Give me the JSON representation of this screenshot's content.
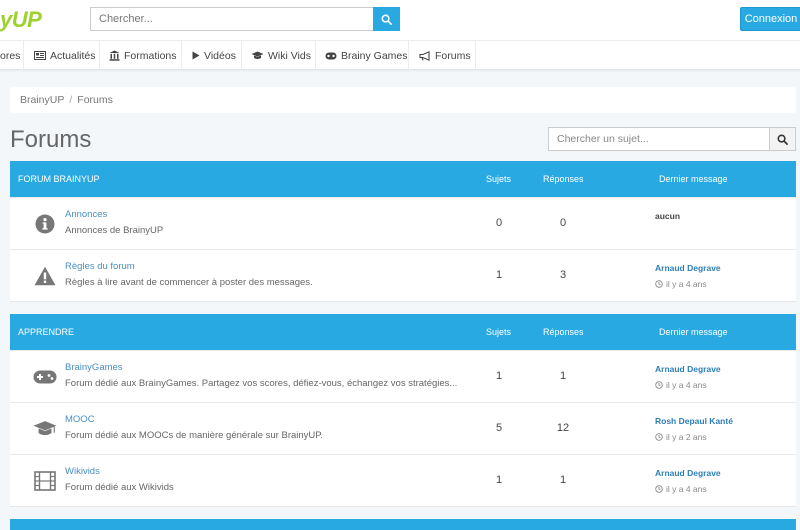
{
  "header": {
    "logo_text": "yUP",
    "search_placeholder": "Chercher...",
    "login_label": "Connexion"
  },
  "nav": {
    "items": [
      {
        "label": "ores",
        "icon": "none"
      },
      {
        "label": "Actualités",
        "icon": "newspaper-icon"
      },
      {
        "label": "Formations",
        "icon": "institution-icon"
      },
      {
        "label": "Vidéos",
        "icon": "play-icon"
      },
      {
        "label": "Wiki Vids",
        "icon": "graduation-cap-icon"
      },
      {
        "label": "Brainy Games",
        "icon": "gamepad-icon"
      },
      {
        "label": "Forums",
        "icon": "bullhorn-icon"
      }
    ]
  },
  "breadcrumb": {
    "home": "BrainyUP",
    "separator": "/",
    "current": "Forums"
  },
  "page": {
    "title": "Forums",
    "topic_search_placeholder": "Chercher un sujet..."
  },
  "sections": [
    {
      "title": "FORUM BRAINYUP",
      "col_subjects": "Sujets",
      "col_replies": "Réponses",
      "col_last": "Dernier message",
      "rows": [
        {
          "icon": "info-circle-icon",
          "title": "Annonces",
          "desc": "Annonces de BrainyUP",
          "subjects": "0",
          "replies": "0",
          "last_user": "aucun",
          "last_time": ""
        },
        {
          "icon": "warning-icon",
          "title": "Règles du forum",
          "desc": "Règles à  lire avant de commencer à  poster des messages.",
          "subjects": "1",
          "replies": "3",
          "last_user": "Arnaud Degrave",
          "last_time": "il y a 4 ans"
        }
      ]
    },
    {
      "title": "APPRENDRE",
      "col_subjects": "Sujets",
      "col_replies": "Réponses",
      "col_last": "Dernier message",
      "rows": [
        {
          "icon": "gamepad-icon",
          "title": "BrainyGames",
          "desc": "Forum dédié aux BrainyGames. Partagez vos scores, défiez-vous, échangez vos stratégies...",
          "subjects": "1",
          "replies": "1",
          "last_user": "Arnaud Degrave",
          "last_time": "il y a 4 ans"
        },
        {
          "icon": "graduation-cap-icon",
          "title": "MOOC",
          "desc": "Forum dédié aux MOOCs de manière générale sur BrainyUP.",
          "subjects": "5",
          "replies": "12",
          "last_user": "Rosh Depaul Kanté",
          "last_time": "il y a 2 ans"
        },
        {
          "icon": "film-icon",
          "title": "Wikivids",
          "desc": "Forum dédié aux Wikivids",
          "subjects": "1",
          "replies": "1",
          "last_user": "Arnaud Degrave",
          "last_time": "il y a 4 ans"
        }
      ]
    }
  ],
  "colors": {
    "accent": "#29a9e1",
    "logo": "#9fd12e",
    "link": "#4a8fbf",
    "user_link": "#2d7fb8"
  }
}
